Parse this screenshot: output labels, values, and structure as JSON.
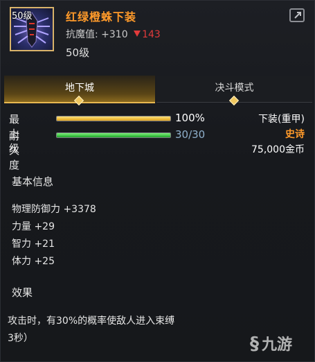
{
  "item": {
    "level_badge": "50级",
    "name": "红绿橙蛛下装",
    "resist_label": "抗魔值: +310",
    "resist_delta": "143",
    "required_level": "50级",
    "icon": "spider-armor-pants-icon"
  },
  "tabs": [
    {
      "label": "地下城",
      "active": true
    },
    {
      "label": "决斗模式",
      "active": false
    }
  ],
  "bars": [
    {
      "label": "最上级",
      "value_text": "100%",
      "fraction": 1.0,
      "color": "#f0b830"
    },
    {
      "label": "耐久度",
      "value_text": "30/30",
      "fraction": 1.0,
      "color": "#3ccf3a"
    }
  ],
  "details": {
    "slot": "下装(重甲)",
    "rarity": "史诗",
    "price": "75,000金币"
  },
  "basic_info": {
    "title": "基本信息",
    "stats": [
      "物理防御力 +3378",
      "力量 +29",
      "智力 +21",
      "体力 +25"
    ]
  },
  "effect": {
    "title": "效果",
    "text": "攻击时，有30%的概率使敌人进入束缚",
    "text2": "3秒）"
  },
  "watermark": "九游",
  "colors": {
    "epic": "#ff9a2a",
    "decrease": "#e23b3b",
    "tab_accent": "#e8b850"
  }
}
